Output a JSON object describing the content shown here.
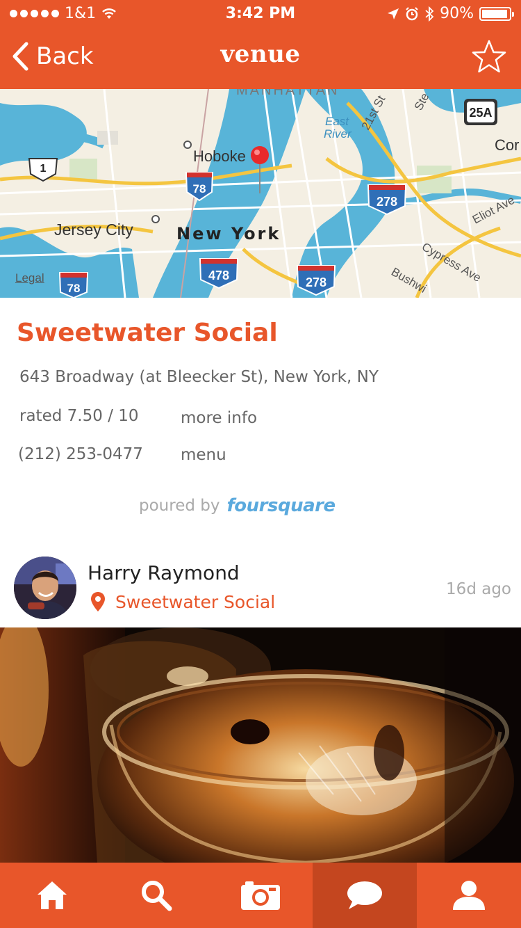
{
  "status_bar": {
    "carrier": "1&1",
    "time": "3:42 PM",
    "battery": "90%",
    "icons": [
      "signal-dots-icon",
      "wifi-icon",
      "location-arrow-icon",
      "alarm-icon",
      "bluetooth-icon",
      "battery-icon"
    ]
  },
  "nav": {
    "back_label": "Back",
    "title": "venue",
    "favorite_icon": "star-outline-icon"
  },
  "map": {
    "legal_label": "Legal",
    "labels": {
      "manhattan": "MANHATTAN",
      "hoboken": "Hoboke",
      "jersey_city": "Jersey City",
      "new_york": "New York",
      "east_river": "East River",
      "east": "East",
      "river": "River",
      "st21": "21st St",
      "cor": "Cor",
      "eliot": "Eliot Ave",
      "cypress": "Cypress Ave",
      "bushwi": "Bushwi",
      "ste": "Ste"
    },
    "shields": {
      "us1": "1",
      "i78a": "78",
      "i78b": "78",
      "i278a": "278",
      "i278b": "278",
      "i478": "478",
      "r25a": "25A"
    }
  },
  "venue": {
    "name": "Sweetwater Social",
    "address": "643 Broadway (at Bleecker St), New York, NY",
    "rating": "rated 7.50 / 10",
    "more_info": "more info",
    "phone": "(212) 253-0477",
    "menu": "menu",
    "poured_by": "poured by",
    "provider": "foursquare"
  },
  "post": {
    "author": "Harry Raymond",
    "venue": "Sweetwater Social",
    "time_ago": "16d ago"
  },
  "tabbar": {
    "tabs": [
      {
        "name": "home",
        "icon": "home-icon",
        "active": false
      },
      {
        "name": "search",
        "icon": "search-icon",
        "active": false
      },
      {
        "name": "camera",
        "icon": "camera-icon",
        "active": false
      },
      {
        "name": "messages",
        "icon": "chat-bubble-icon",
        "active": true
      },
      {
        "name": "profile",
        "icon": "person-icon",
        "active": false
      }
    ]
  },
  "colors": {
    "brand": "#e8562a",
    "brand_dark": "#c4461f",
    "foursquare": "#5aa9dd"
  }
}
